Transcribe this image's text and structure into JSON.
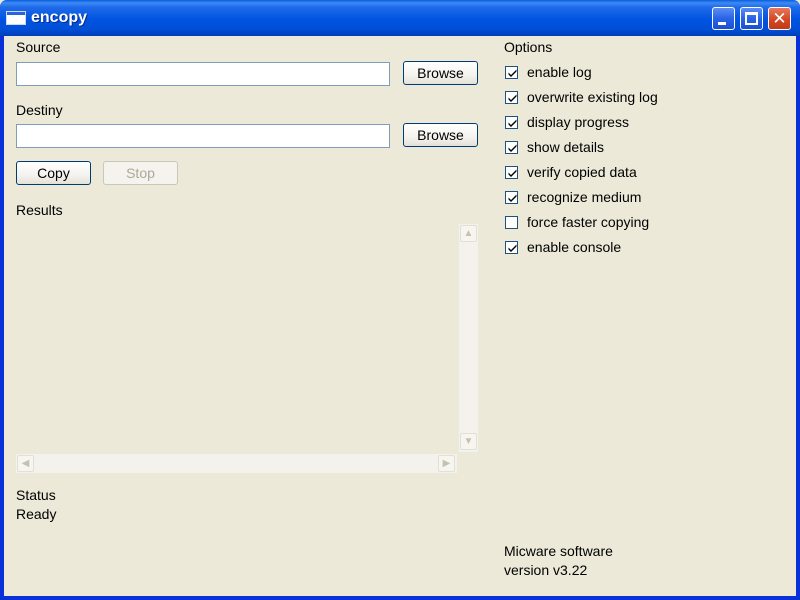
{
  "window": {
    "title": "encopy",
    "title_color": "#FFFFFF",
    "titlebar_color": "#0053E1",
    "close_color": "#D34724",
    "minimize_icon": "minimize-icon",
    "maximize_icon": "maximize-icon",
    "close_icon": "close-icon",
    "close_glyph": "✕"
  },
  "source": {
    "label": "Source",
    "value": "",
    "browse_label": "Browse"
  },
  "destiny": {
    "label": "Destiny",
    "value": "",
    "browse_label": "Browse"
  },
  "actions": {
    "copy_label": "Copy",
    "stop_label": "Stop"
  },
  "results": {
    "label": "Results",
    "content": ""
  },
  "options": {
    "label": "Options",
    "items": [
      {
        "label": "enable log",
        "checked": true
      },
      {
        "label": "overwrite existing log",
        "checked": true
      },
      {
        "label": "display progress",
        "checked": true
      },
      {
        "label": "show details",
        "checked": true
      },
      {
        "label": "verify copied data",
        "checked": true
      },
      {
        "label": "recognize medium",
        "checked": true
      },
      {
        "label": "force faster copying",
        "checked": false
      },
      {
        "label": "enable console",
        "checked": true
      }
    ]
  },
  "status": {
    "label": "Status",
    "value": "Ready"
  },
  "footer": {
    "company": "Micware software",
    "version": "version v3.22"
  }
}
